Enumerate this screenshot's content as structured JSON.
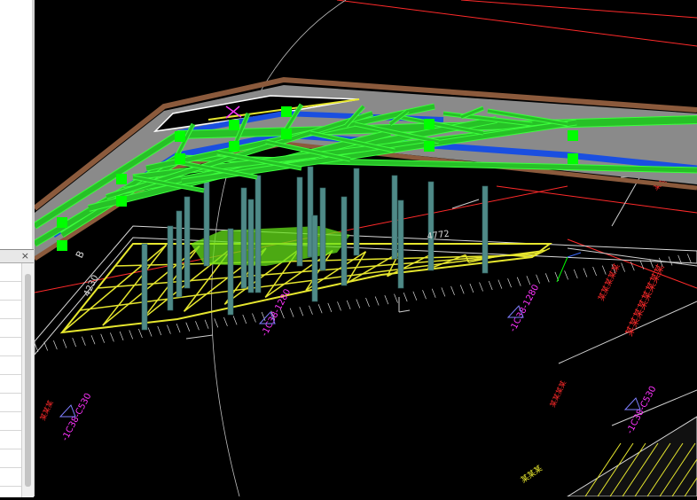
{
  "float_panel": {
    "close_glyph": "×",
    "row_count": 12
  },
  "drawing": {
    "section_labels": [
      "-1C38-1280",
      "-1C38-1280",
      "-1C38-C530",
      "-1C38-C530"
    ],
    "grid_labels": [
      "B",
      "4230",
      "4772"
    ],
    "red_notes": [
      "某某某某某",
      "某某某某某某某某",
      "某某某某",
      "某某某"
    ],
    "colors": {
      "background": "#000000",
      "beams": "#27c127",
      "beam_outline": "#3cff3c",
      "slab": "#8a8a8a",
      "parapet": "#8b5a3c",
      "water_channel": "#1a4fe0",
      "piles": "#4f8a88",
      "truss": "#e6e62e",
      "labels": "#ff33ff",
      "notes": "#ff2a2a",
      "grips": "#00ff00",
      "arc": "#bfbfbf"
    }
  }
}
